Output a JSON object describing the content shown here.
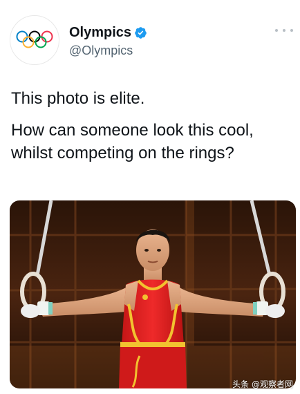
{
  "author": {
    "name": "Olympics",
    "handle": "@Olympics",
    "verified": true,
    "avatar_icon": "olympic-rings-icon"
  },
  "tweet": {
    "text_line1": "This photo is elite.",
    "text_line2": "How can someone look this cool, whilst competing on the rings?"
  },
  "watermark": "头条 @观察者网",
  "colors": {
    "verified_blue": "#1d9bf0",
    "ring_blue": "#0081c8",
    "ring_yellow": "#fcb131",
    "ring_black": "#000000",
    "ring_green": "#00a651",
    "ring_red": "#ee334e",
    "uniform_red": "#e02020",
    "uniform_gold": "#f2c230"
  }
}
